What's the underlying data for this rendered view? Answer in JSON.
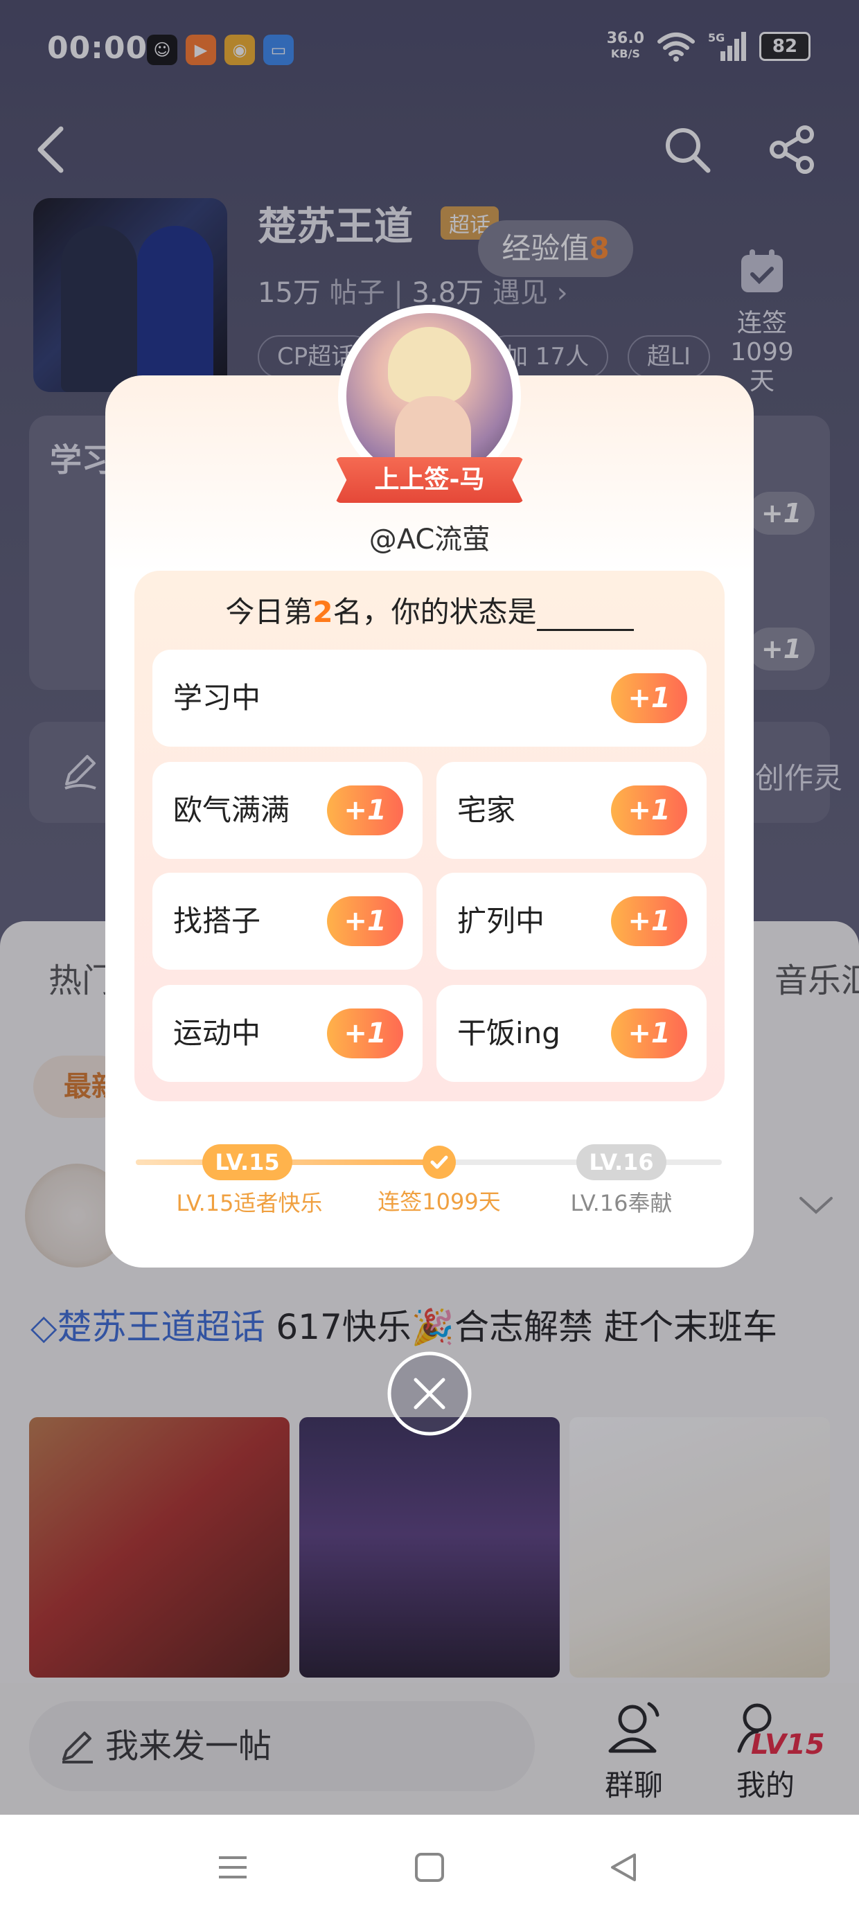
{
  "status_bar": {
    "time": "00:00",
    "net_speed_value": "36.0",
    "net_speed_unit": "KB/S",
    "network": "5G",
    "battery": "82"
  },
  "topic": {
    "title": "楚苏王道",
    "badge": "超话",
    "posts_count": "15万",
    "posts_label": "帖子",
    "meet_count": "3.8万",
    "meet_label": "遇见",
    "tags": [
      "CP超话",
      "加 17人",
      "超LI"
    ],
    "checkin_label": "连签",
    "checkin_days": "1099天"
  },
  "exp_popup": {
    "label": "经验值",
    "value": "8"
  },
  "background": {
    "card_title": "学习",
    "plus_label": "+1",
    "creator_text": "创作灵",
    "tab_hot": "热门",
    "tab_music": "音乐汇",
    "sort_label": "最新",
    "post_topic": "楚苏王道超话",
    "post_text": "617快乐🎉合志解禁 赶个末班车"
  },
  "modal": {
    "ribbon_text": "上上签-马",
    "username": "@AC流萤",
    "rank_prefix": "今日第",
    "rank_number": "2",
    "rank_suffix": "名，你的状态是",
    "options": [
      {
        "label": "学习中",
        "action": "+1"
      },
      {
        "label": "欧气满满",
        "action": "+1"
      },
      {
        "label": "宅家",
        "action": "+1"
      },
      {
        "label": "找搭子",
        "action": "+1"
      },
      {
        "label": "扩列中",
        "action": "+1"
      },
      {
        "label": "运动中",
        "action": "+1"
      },
      {
        "label": "干饭ing",
        "action": "+1"
      }
    ],
    "level_current": "LV.15",
    "level_current_label": "LV.15适者快乐",
    "checkin_label": "连签1099天",
    "level_next": "LV.16",
    "level_next_label": "LV.16奉献",
    "level_progress": 0.5
  },
  "bottom_bar": {
    "compose_placeholder": "我来发一帖",
    "group_chat": "群聊",
    "mine": "我的",
    "mine_level": "LV15"
  },
  "colors": {
    "accent_orange": "#ff7a1a",
    "plus_gradient_start": "#ffb24a",
    "plus_gradient_end": "#ff6a52",
    "ribbon": "#e54838",
    "link_blue": "#3a6bd6"
  },
  "icons": [
    "back-icon",
    "search-icon",
    "share-icon",
    "calendar-icon",
    "pen-icon",
    "close-icon",
    "group-chat-icon",
    "profile-icon",
    "menu-icon",
    "home-icon",
    "nav-back-icon"
  ]
}
